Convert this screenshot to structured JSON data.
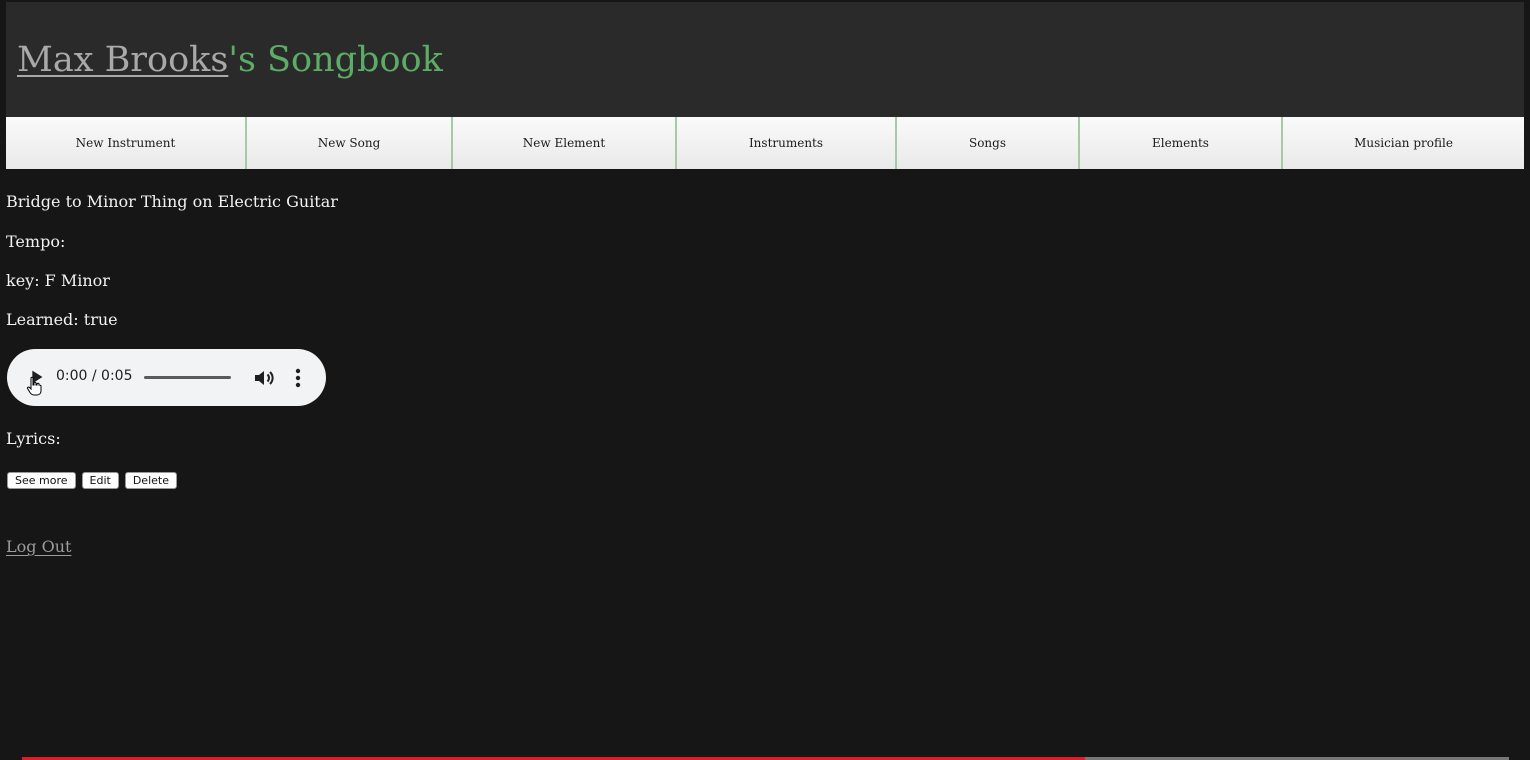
{
  "header": {
    "owner_name": "Max Brooks",
    "title_suffix": "'s Songbook",
    "title_color": "#5cac66"
  },
  "nav": {
    "items": [
      {
        "label": "New Instrument"
      },
      {
        "label": "New Song"
      },
      {
        "label": "New Element"
      },
      {
        "label": "Instruments"
      },
      {
        "label": "Songs"
      },
      {
        "label": "Elements"
      },
      {
        "label": "Musician profile"
      }
    ]
  },
  "element": {
    "heading": "Bridge to Minor Thing on Electric Guitar",
    "tempo": "Tempo:",
    "key": "key: F Minor",
    "learned": "Learned: true",
    "lyrics": "Lyrics:"
  },
  "audio": {
    "time": "0:00 / 0:05",
    "play_icon": "play-icon",
    "volume_icon": "volume-icon",
    "menu_icon": "more-vert-icon"
  },
  "actions": {
    "see_more": "See more",
    "edit": "Edit",
    "delete": "Delete"
  },
  "footer": {
    "logout": "Log Out"
  },
  "video_progress": {
    "fraction": 0.715,
    "color": "#e31b23"
  }
}
